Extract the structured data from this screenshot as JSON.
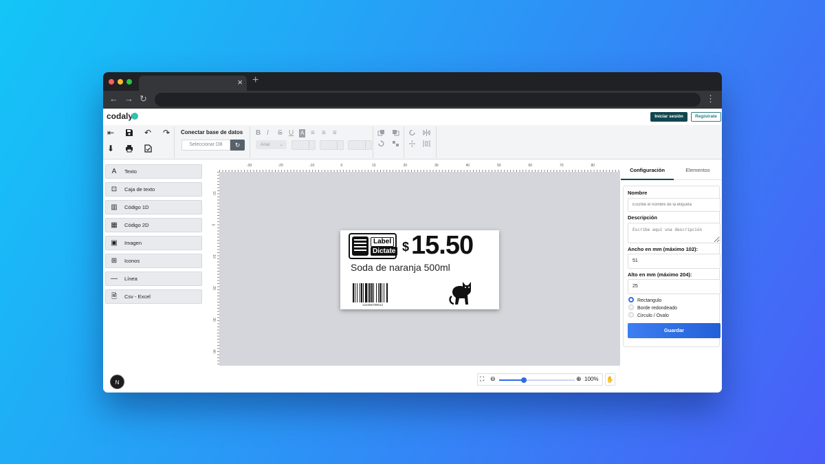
{
  "browser": {
    "tab_close": "×",
    "new_tab": "+",
    "back": "←",
    "forward": "→",
    "reload": "↻",
    "menu": "⋮",
    "colors": {
      "close": "#ff5f57",
      "minimize": "#febc2e",
      "maximize": "#28c840"
    }
  },
  "app": {
    "logo": "codaly",
    "login_label": "Iniciar sesión",
    "register_label": "Registrate"
  },
  "toolbar": {
    "db_title": "Conectar base de datos",
    "db_select": "Seleccionar DB",
    "font_value": "Arial",
    "icons": {
      "indent": "⇤",
      "save": "💾",
      "undo": "↶",
      "redo": "↷",
      "download": "⬇",
      "print": "🖶",
      "export": "🗎",
      "bold": "B",
      "italic": "I",
      "strike": "S",
      "underline": "U",
      "case": "A",
      "align_left": "≡",
      "align_center": "≡",
      "align_right": "≡",
      "refresh": "↻",
      "dropdown": "⌄"
    }
  },
  "sidebar": {
    "items": [
      {
        "icon": "A",
        "label": "Texto"
      },
      {
        "icon": "⊡",
        "label": "Caja de texto"
      },
      {
        "icon": "▥",
        "label": "Código 1D"
      },
      {
        "icon": "▦",
        "label": "Código 2D"
      },
      {
        "icon": "▣",
        "label": "Imagen"
      },
      {
        "icon": "⊞",
        "label": "Iconos"
      },
      {
        "icon": "—",
        "label": "Línea"
      },
      {
        "icon": "🗎",
        "label": "Csv - Excel"
      }
    ],
    "badge": "N"
  },
  "rulers": {
    "top": [
      "-30",
      "-20",
      "-10",
      "0",
      "10",
      "20",
      "30",
      "40",
      "50",
      "60",
      "70",
      "80"
    ],
    "left": [
      "10",
      "0",
      "10",
      "20",
      "30",
      "40"
    ]
  },
  "label": {
    "logo_line1": "Label",
    "logo_line2": "Dictate",
    "currency": "$",
    "price": "15.50",
    "product": "Soda de naranja 500ml",
    "barcode_number": "123456789012"
  },
  "zoom": {
    "level_text": "100%",
    "level": 0.33,
    "zoom_out": "⊖",
    "zoom_in": "⊕",
    "fit": "⛶",
    "hand": "✋"
  },
  "panel": {
    "tab_config": "Configuración",
    "tab_elements": "Elementos",
    "name_label": "Nombre",
    "name_placeholder": "Escribe el nombre de la etiqueta",
    "desc_label": "Descripción",
    "desc_placeholder": "Escribe aquí una descripción",
    "width_label": "Ancho en mm (máximo 102):",
    "width_value": "51",
    "height_label": "Alto en mm (máximo 204):",
    "height_value": "25",
    "shapes": [
      "Rectangulo",
      "Borde redondeado",
      "Circulo / Ovalo"
    ],
    "selected_shape": "Rectangulo",
    "save_label": "Guardar"
  }
}
